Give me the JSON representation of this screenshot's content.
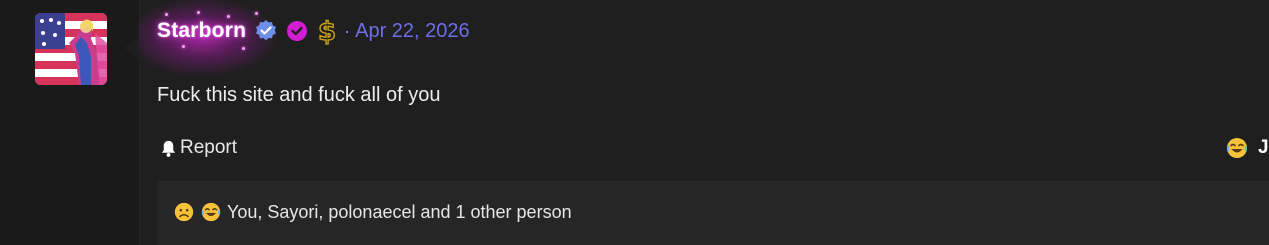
{
  "post": {
    "username": "Starborn",
    "separator": "·",
    "date": "Apr 22, 2026",
    "message": "Fuck this site and fuck all of you",
    "report_label": "Report",
    "reaction_button_label": "JI",
    "reactions_summary": "You, Sayori, polonaecel and 1 other person"
  },
  "icons": {
    "verified": "verified-check-icon",
    "purple_check": "purple-check-icon",
    "dollar": "dollar-sign-icon",
    "bell": "bell-icon",
    "sad_face": "sad-face-emoji",
    "laugh_cry": "laugh-cry-emoji"
  },
  "colors": {
    "date": "#6e6ee6",
    "verified_badge": "#6f8ee8",
    "purple_badge": "#d21ed2",
    "dollar_badge": "#c9a21a",
    "username_glow": "#e040e0"
  }
}
